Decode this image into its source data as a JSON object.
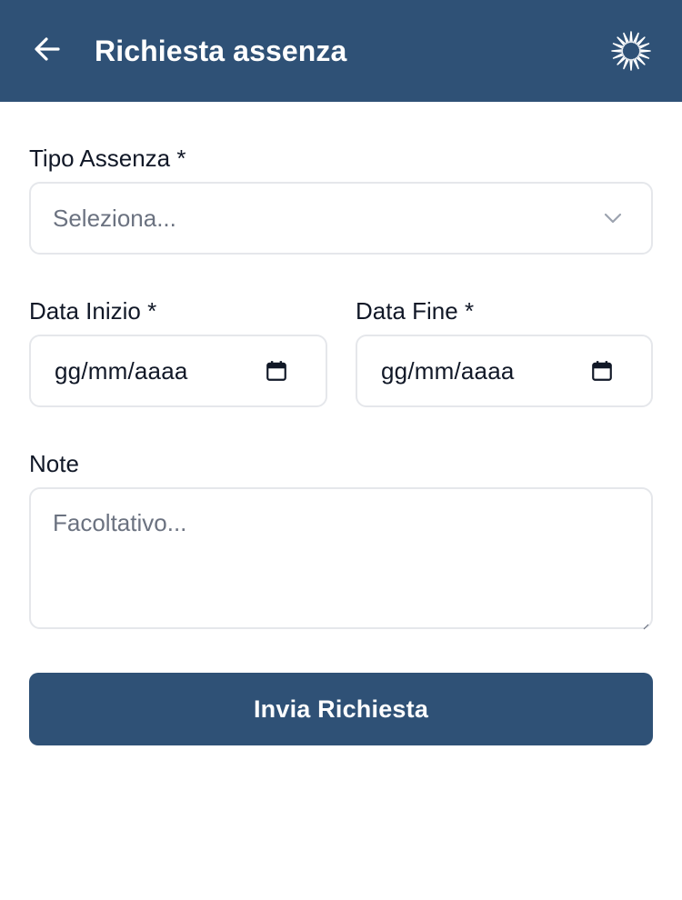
{
  "app_bar": {
    "title": "Richiesta assenza",
    "back_icon": "arrow-left-icon",
    "logo_icon": "starburst-logo-icon",
    "background": "#2f5176"
  },
  "form": {
    "absence_type": {
      "label": "Tipo Assenza *",
      "placeholder": "Seleziona...",
      "icon": "chevron-down-icon"
    },
    "start_date": {
      "label": "Data Inizio *",
      "value": "gg/mm/aaaa",
      "icon": "calendar-icon"
    },
    "end_date": {
      "label": "Data Fine *",
      "value": "gg/mm/aaaa",
      "icon": "calendar-icon"
    },
    "notes": {
      "label": "Note",
      "placeholder": "Facoltativo..."
    },
    "submit": {
      "label": "Invia Richiesta"
    }
  },
  "colors": {
    "primary": "#2f5176",
    "border": "#e5e7eb",
    "placeholder": "#6b7280",
    "text": "#111827"
  }
}
